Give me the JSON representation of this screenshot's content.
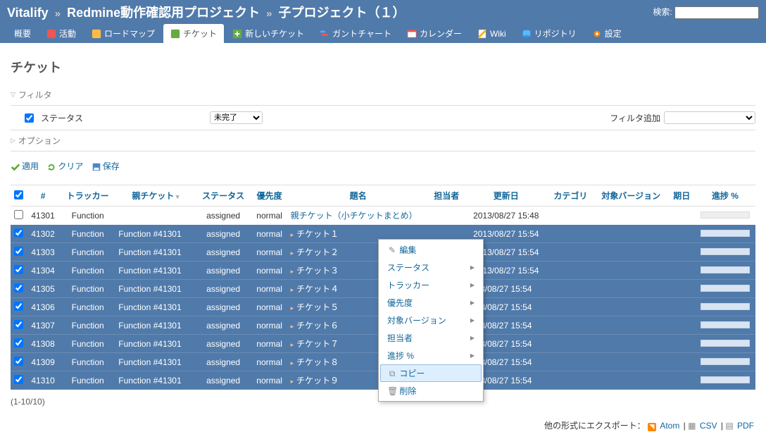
{
  "breadcrumbs": {
    "root": "Vitalify",
    "parent": "Redmine動作確認用プロジェクト",
    "current": "子プロジェクト（１）"
  },
  "search_label": "検索:",
  "tabs": {
    "overview": "概要",
    "activity": "活動",
    "roadmap": "ロードマップ",
    "issues": "チケット",
    "new_issue": "新しいチケット",
    "gantt": "ガントチャート",
    "calendar": "カレンダー",
    "wiki": "Wiki",
    "repository": "リポジトリ",
    "settings": "設定"
  },
  "page_title": "チケット",
  "filter": {
    "legend": "フィルタ",
    "status_label": "ステータス",
    "status_value": "未完了",
    "options_label": "オプション",
    "add_label": "フィルタ追加"
  },
  "actions": {
    "apply": "適用",
    "clear": "クリア",
    "save": "保存"
  },
  "columns": {
    "id": "#",
    "tracker": "トラッカー",
    "parent": "親チケット",
    "status": "ステータス",
    "priority": "優先度",
    "subject": "題名",
    "assignee": "担当者",
    "updated": "更新日",
    "category": "カテゴリ",
    "version": "対象バージョン",
    "due": "期日",
    "done": "進捗 %"
  },
  "rows": [
    {
      "id": "41301",
      "tracker": "Function",
      "parent": "",
      "status": "assigned",
      "priority": "normal",
      "subject": "親チケット（小チケットまとめ）",
      "updated": "2013/08/27 15:48",
      "checked": false,
      "selected": false,
      "indent": false
    },
    {
      "id": "41302",
      "tracker": "Function",
      "parent": "Function #41301",
      "status": "assigned",
      "priority": "normal",
      "subject": "チケット１",
      "updated": "2013/08/27 15:54",
      "checked": true,
      "selected": true,
      "indent": true
    },
    {
      "id": "41303",
      "tracker": "Function",
      "parent": "Function #41301",
      "status": "assigned",
      "priority": "normal",
      "subject": "チケット２",
      "updated": "2013/08/27 15:54",
      "checked": true,
      "selected": true,
      "indent": true
    },
    {
      "id": "41304",
      "tracker": "Function",
      "parent": "Function #41301",
      "status": "assigned",
      "priority": "normal",
      "subject": "チケット３",
      "updated": "2013/08/27 15:54",
      "checked": true,
      "selected": true,
      "indent": true
    },
    {
      "id": "41305",
      "tracker": "Function",
      "parent": "Function #41301",
      "status": "assigned",
      "priority": "normal",
      "subject": "チケット４",
      "updated": "3/08/27 15:54",
      "checked": true,
      "selected": true,
      "indent": true
    },
    {
      "id": "41306",
      "tracker": "Function",
      "parent": "Function #41301",
      "status": "assigned",
      "priority": "normal",
      "subject": "チケット５",
      "updated": "3/08/27 15:54",
      "checked": true,
      "selected": true,
      "indent": true
    },
    {
      "id": "41307",
      "tracker": "Function",
      "parent": "Function #41301",
      "status": "assigned",
      "priority": "normal",
      "subject": "チケット６",
      "updated": "3/08/27 15:54",
      "checked": true,
      "selected": true,
      "indent": true
    },
    {
      "id": "41308",
      "tracker": "Function",
      "parent": "Function #41301",
      "status": "assigned",
      "priority": "normal",
      "subject": "チケット７",
      "updated": "3/08/27 15:54",
      "checked": true,
      "selected": true,
      "indent": true
    },
    {
      "id": "41309",
      "tracker": "Function",
      "parent": "Function #41301",
      "status": "assigned",
      "priority": "normal",
      "subject": "チケット８",
      "updated": "3/08/27 15:54",
      "checked": true,
      "selected": true,
      "indent": true
    },
    {
      "id": "41310",
      "tracker": "Function",
      "parent": "Function #41301",
      "status": "assigned",
      "priority": "normal",
      "subject": "チケット９",
      "updated": "3/08/27 15:54",
      "checked": true,
      "selected": true,
      "indent": true
    }
  ],
  "pagination": "(1-10/10)",
  "export": {
    "label": "他の形式にエクスポート：",
    "atom": "Atom",
    "csv": "CSV",
    "pdf": "PDF"
  },
  "context_menu": {
    "edit": "編集",
    "status": "ステータス",
    "tracker": "トラッカー",
    "priority": "優先度",
    "version": "対象バージョン",
    "assignee": "担当者",
    "done": "進捗 %",
    "copy": "コピー",
    "delete": "削除"
  }
}
